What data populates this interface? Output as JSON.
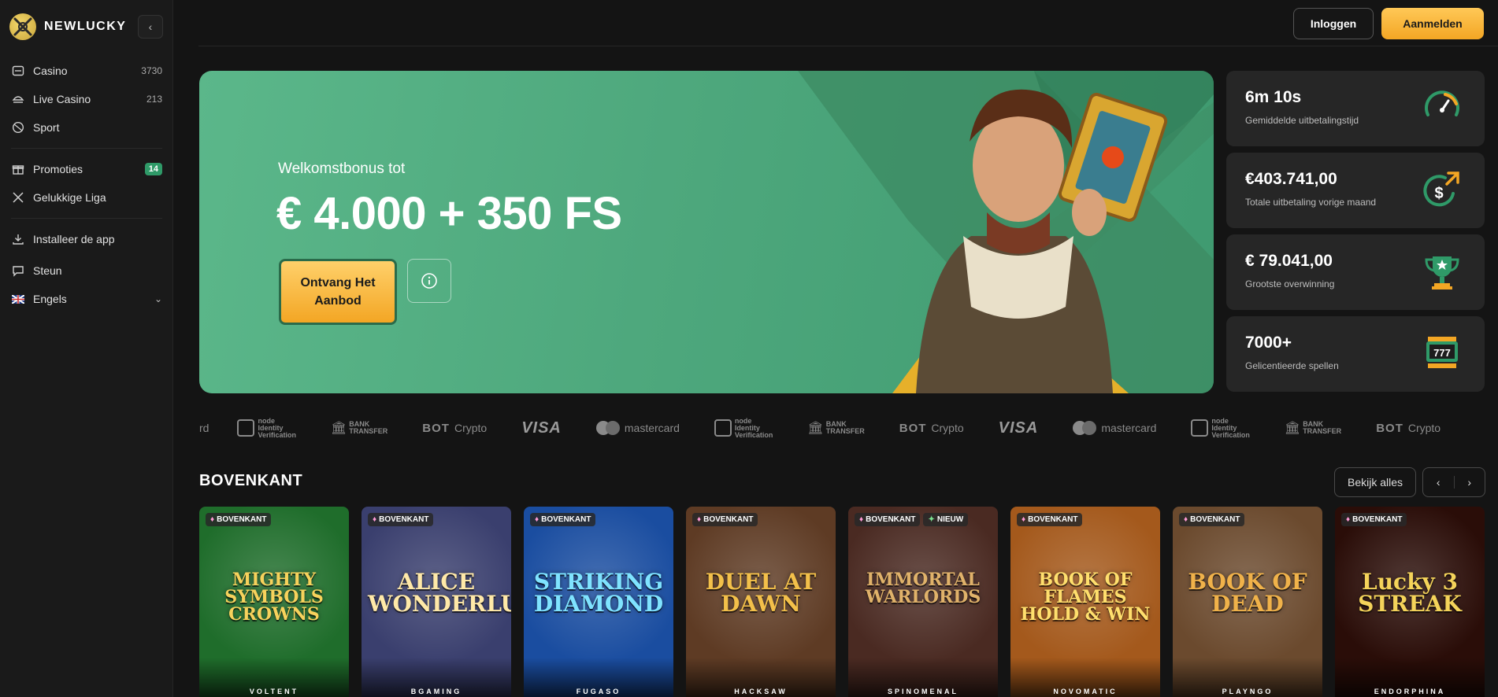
{
  "brand": {
    "name": "NEWLUCKY"
  },
  "sidebar": {
    "items": [
      {
        "label": "Casino",
        "count": "3730",
        "icon": "slot-machine-icon"
      },
      {
        "label": "Live Casino",
        "count": "213",
        "icon": "live-dealer-icon"
      },
      {
        "label": "Sport",
        "count": "",
        "icon": "ball-icon"
      },
      {
        "label": "Promoties",
        "badge": "14",
        "icon": "gift-icon"
      },
      {
        "label": "Gelukkige Liga",
        "icon": "swords-icon"
      },
      {
        "label": "Installeer de app",
        "icon": "download-icon"
      },
      {
        "label": "Steun",
        "icon": "chat-icon"
      },
      {
        "label": "Engels",
        "icon": "uk-flag-icon"
      }
    ]
  },
  "header": {
    "login_label": "Inloggen",
    "signup_label": "Aanmelden"
  },
  "hero": {
    "subtitle": "Welkomstbonus tot",
    "title": "€ 4.000 + 350 FS",
    "cta_label": "Ontvang Het Aanbod"
  },
  "stats": [
    {
      "value": "6m 10s",
      "caption": "Gemiddelde uitbetalingstijd",
      "icon": "speedometer-icon"
    },
    {
      "value": "€403.741,00",
      "caption": "Totale uitbetaling vorige maand",
      "icon": "dollar-up-icon"
    },
    {
      "value": "€ 79.041,00",
      "caption": "Grootste overwinning",
      "icon": "trophy-icon"
    },
    {
      "value": "7000+",
      "caption": "Gelicentieerde spellen",
      "icon": "slot-777-icon"
    }
  ],
  "payments": {
    "identity_small": "node",
    "identity_line1": "Identity",
    "identity_line2": "Verification",
    "bank_small": "BANK",
    "bank_line": "TRANSFER",
    "crypto": "Crypto",
    "crypto_mark": "BOT",
    "visa": "VISA",
    "mastercard": "mastercard",
    "leading_fragment": "rd"
  },
  "section": {
    "title": "BOVENKANT",
    "see_all_label": "Bekijk alles"
  },
  "games": [
    {
      "tag": "BOVENKANT",
      "title": "MIGHTY SYMBOLS CROWNS",
      "provider": "VOLTENT",
      "bg": "#1f6d2b",
      "title_color": "#f7d25c"
    },
    {
      "tag": "BOVENKANT",
      "title": "ALICE WONDERLUCK",
      "provider": "BGAMING",
      "bg": "#3a3f6e",
      "title_color": "#ffe9a8"
    },
    {
      "tag": "BOVENKANT",
      "title": "STRIKING DIAMOND",
      "provider": "FUGASO",
      "bg": "#1a4da0",
      "title_color": "#7fe3ff"
    },
    {
      "tag": "BOVENKANT",
      "title": "DUEL AT DAWN",
      "provider": "HACKSAW",
      "bg": "#5e3b24",
      "title_color": "#f3c04a"
    },
    {
      "tag": "BOVENKANT",
      "tag2": "NIEUW",
      "title": "IMMORTAL WARLORDS",
      "provider": "SPINOMENAL",
      "bg": "#4a2a22",
      "title_color": "#e0b26a"
    },
    {
      "tag": "BOVENKANT",
      "title": "BOOK OF FLAMES HOLD & WIN",
      "provider": "NOVOMATIC",
      "bg": "#a4591c",
      "title_color": "#ffdf6d"
    },
    {
      "tag": "BOVENKANT",
      "title": "BOOK OF DEAD",
      "provider": "PLAYNGO",
      "bg": "#6b4a2e",
      "title_color": "#f0b24a"
    },
    {
      "tag": "BOVENKANT",
      "title": "Lucky 3 STREAK",
      "provider": "ENDORPHINA",
      "bg": "#2a0d08",
      "title_color": "#f4d35a"
    }
  ],
  "colors": {
    "accent": "#f3a624",
    "hero_green": "#4ea87d",
    "badge_green": "#2f9a68"
  }
}
